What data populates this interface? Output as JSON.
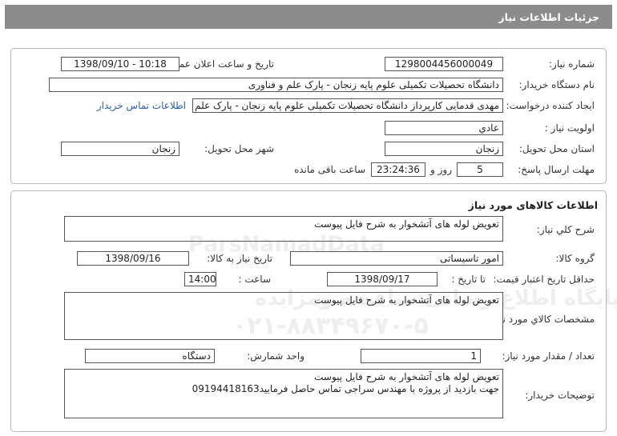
{
  "header": {
    "title": "جزئیات اطلاعات نیاز"
  },
  "need": {
    "number_label": "شماره نیاز:",
    "number": "1298004456000049",
    "announce_label": "تاریخ و ساعت اعلان عمومی:",
    "announce": "1398/09/10 - 10:18",
    "buyer_org_label": "نام دستگاه خریدار:",
    "buyer_org": "دانشگاه تحصیلات تکمیلی علوم پایه زنجان - پارک علم و فناوری",
    "creator_label": "ایجاد کننده درخواست:",
    "creator": "مهدی قدمایی کارپرداز دانشگاه تحصیلات تکمیلی علوم پایه زنجان - پارک علم و فناوری",
    "contact_link": "اطلاعات تماس خریدار",
    "priority_label": "اولویت نیاز :",
    "priority": "عادي",
    "province_label": "استان محل تحویل:",
    "province": "زنجان",
    "city_label": "شهر محل تحویل:",
    "city": "زنجان",
    "deadline_label": "مهلت ارسال پاسخ:",
    "days": "5",
    "days_unit": "روز و",
    "time_left": "23:24:36",
    "time_left_suffix": "ساعت باقی مانده"
  },
  "goods": {
    "section_title": "اطلاعات کالاهای مورد نیاز",
    "summary_label": "شرح کلي نياز:",
    "summary": "تعویض لوله های آتشخوار به شرح فایل پیوست",
    "group_label": "گروه کالا:",
    "group": "امور تاسیساتی",
    "need_date_label": "تاریخ نیاز به کالا:",
    "need_date": "1398/09/16",
    "validity_label": "حداقل تاریخ اعتبار قیمت:",
    "until_label": "تا تاریخ :",
    "validity_date": "1398/09/17",
    "hour_label": "ساعت :",
    "validity_time": "14:00",
    "specs_label": "مشخصات کالاي مورد نياز:",
    "specs": "تعویض لوله های آتشخوار به شرح فایل پیوست",
    "qty_label": "تعداد / مقدار مورد نیاز:",
    "qty": "1",
    "unit_label": "واحد شمارش:",
    "unit": "دستگاه",
    "notes_label": "توضیحات خریدار:",
    "notes": "تعویض لوله های آتشخوار به شرح فایل پیوست\nجهت بازدید از پروژه با مهندس سراجی تماس حاصل فرمایید09194418163"
  },
  "watermark": {
    "brand": "ParsNamadData",
    "site": "پایگاه اطلاع رسانی مناقصه ومزایده",
    "phone": "۰۲۱-۸۸۳۴۹۶۷۰-۵"
  }
}
